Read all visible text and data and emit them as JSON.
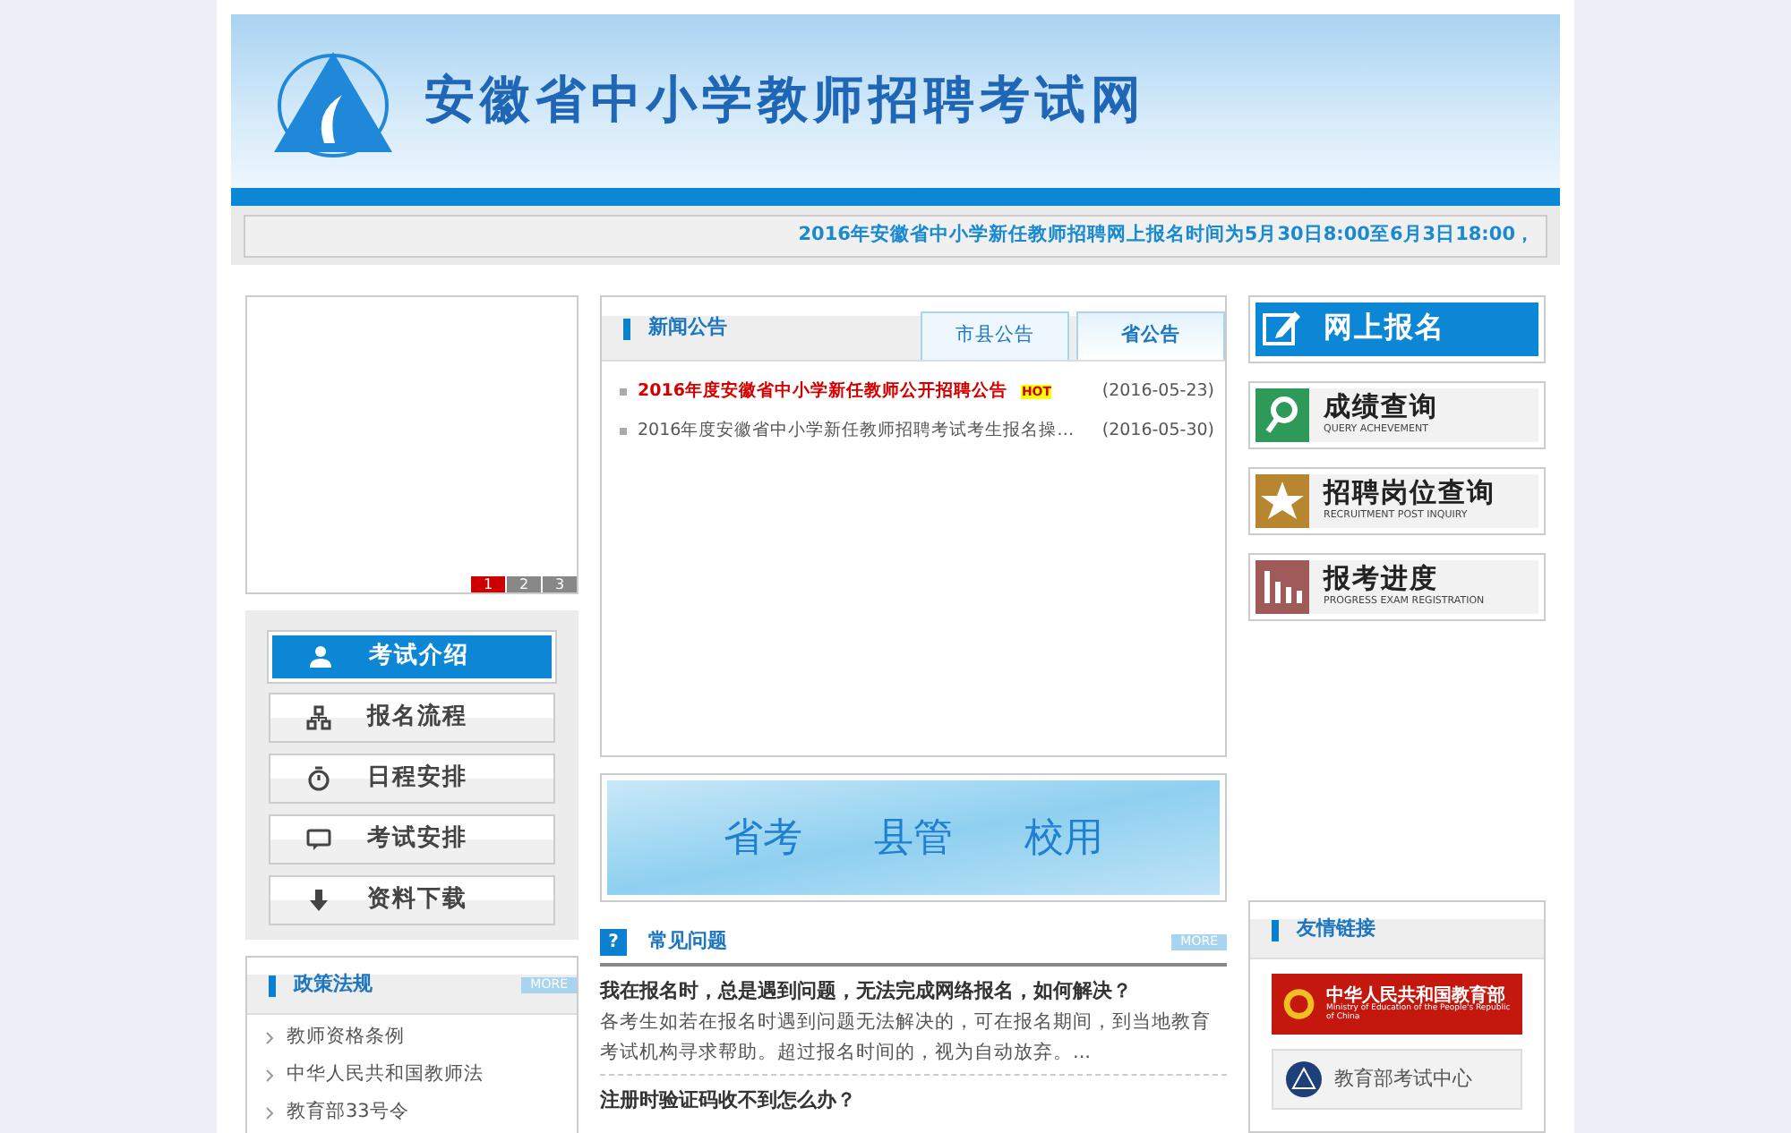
{
  "header": {
    "title": "安徽省中小学教师招聘考试网",
    "ticker": "2016年安徽省中小学新任教师招聘网上报名时间为5月30日8:00至6月3日18:00，"
  },
  "slider": {
    "pages": [
      {
        "label": "1",
        "selected": true
      },
      {
        "label": "2",
        "selected": false
      },
      {
        "label": "3",
        "selected": false
      }
    ]
  },
  "side_menu": [
    {
      "kind": "user",
      "label": "考试介绍",
      "selected": true
    },
    {
      "kind": "flow",
      "label": "报名流程",
      "selected": false
    },
    {
      "kind": "timer",
      "label": "日程安排",
      "selected": false
    },
    {
      "kind": "chat",
      "label": "考试安排",
      "selected": false
    },
    {
      "kind": "download",
      "label": "资料下载",
      "selected": false
    }
  ],
  "policy": {
    "title": "政策法规",
    "more": "MORE",
    "items": [
      "教师资格条例",
      "中华人民共和国教师法",
      "教育部33号令"
    ]
  },
  "news": {
    "title": "新闻公告",
    "tabs": [
      {
        "label": "市县公告",
        "selected": false
      },
      {
        "label": "省公告",
        "selected": true
      }
    ],
    "items": [
      {
        "title": "2016年度安徽省中小学新任教师公开招聘公告",
        "hot": true,
        "badge": "HOT",
        "date": "(2016-05-23)"
      },
      {
        "title": "2016年度安徽省中小学新任教师招聘考试考生报名操…",
        "hot": false,
        "date": "(2016-05-30)"
      }
    ]
  },
  "banner": {
    "words": [
      "省考",
      "县管",
      "校用"
    ]
  },
  "quick_links": [
    {
      "kind": "signup",
      "title": "网上报名"
    },
    {
      "kind": "score",
      "title": "成绩查询",
      "subtitle": "QUERY ACHEVEMENT"
    },
    {
      "kind": "post",
      "title": "招聘岗位查询",
      "subtitle": "RECRUITMENT POST INQUIRY"
    },
    {
      "kind": "progress",
      "title": "报考进度",
      "subtitle": "PROGRESS EXAM REGISTRATION"
    }
  ],
  "faq": {
    "icon": "?",
    "title": "常见问题",
    "more": "MORE",
    "items": [
      {
        "question": "我在报名时，总是遇到问题，无法完成网络报名，如何解决？",
        "answer": "各考生如若在报名时遇到问题无法解决的，可在报名期间，到当地教育考试机构寻求帮助。超过报名时间的，视为自动放弃。..."
      },
      {
        "question": "注册时验证码收不到怎么办？"
      }
    ]
  },
  "friend_links": {
    "title": "友情链接",
    "links": [
      {
        "kind": "moe",
        "title": "中华人民共和国教育部",
        "subtitle": "Ministry of Education of the People's Republic of China"
      },
      {
        "kind": "neea",
        "title": "教育部考试中心"
      }
    ]
  }
}
